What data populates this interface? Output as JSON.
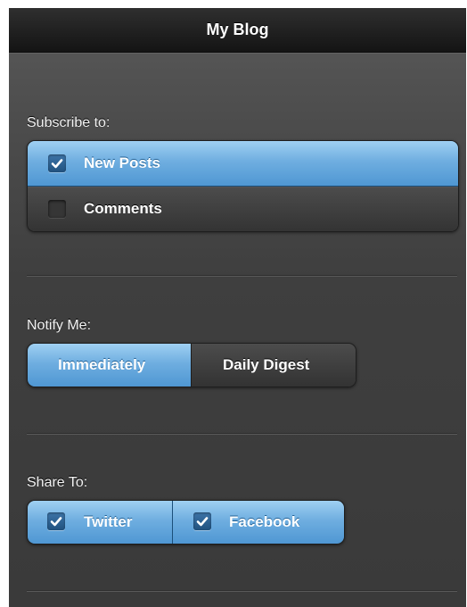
{
  "header": {
    "title": "My Blog"
  },
  "subscribe": {
    "label": "Subscribe to:",
    "options": [
      {
        "label": "New Posts",
        "checked": true
      },
      {
        "label": "Comments",
        "checked": false
      }
    ]
  },
  "notify": {
    "label": "Notify Me:",
    "options": [
      {
        "label": "Immediately",
        "selected": true
      },
      {
        "label": "Daily Digest",
        "selected": false
      }
    ]
  },
  "share": {
    "label": "Share To:",
    "options": [
      {
        "label": "Twitter",
        "checked": true
      },
      {
        "label": "Facebook",
        "checked": true
      }
    ]
  },
  "colors": {
    "active": "#6faee0",
    "inactive": "#404040",
    "header": "#1e1e1e"
  },
  "icons": {
    "check": "checkmark-icon"
  }
}
